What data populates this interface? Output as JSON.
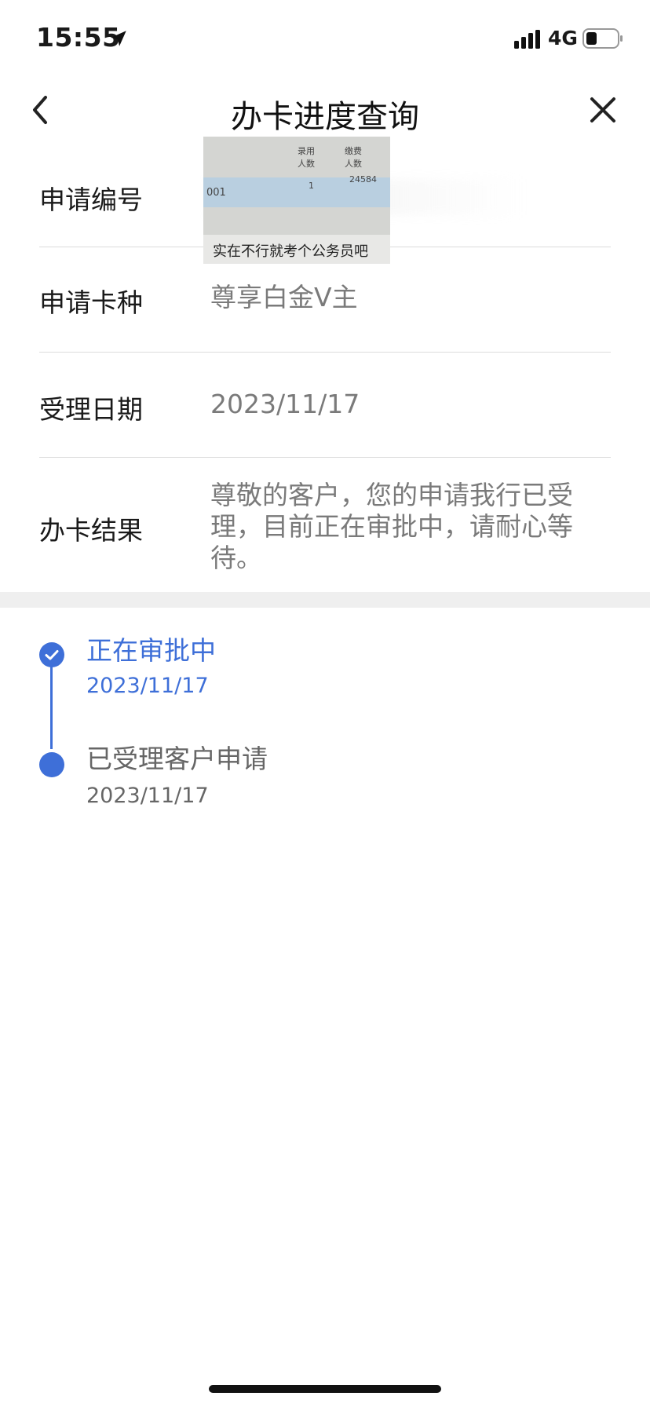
{
  "status_bar": {
    "time": "15:55",
    "network": "4G"
  },
  "nav": {
    "title": "办卡进度查询"
  },
  "info": {
    "application_number": {
      "label": "申请编号"
    },
    "card_type": {
      "label": "申请卡种",
      "value": "尊享白金V主"
    },
    "accept_date": {
      "label": "受理日期",
      "value": "2023/11/17"
    },
    "result": {
      "label": "办卡结果",
      "value": "尊敬的客户，您的申请我行已受理，目前正在审批中，请耐心等待。"
    }
  },
  "sticker": {
    "header_1": "录用\n人数",
    "header_2": "缴费\n人数",
    "code": "001",
    "value_1": "1",
    "value_2": "24584",
    "caption": "实在不行就考个公务员吧"
  },
  "timeline": [
    {
      "title": "正在审批中",
      "date": "2023/11/17",
      "status": "current"
    },
    {
      "title": "已受理客户申请",
      "date": "2023/11/17",
      "status": "done"
    }
  ],
  "colors": {
    "accent": "#3e6fd8",
    "label": "#1a1a1a",
    "value": "#7a7a7a"
  }
}
